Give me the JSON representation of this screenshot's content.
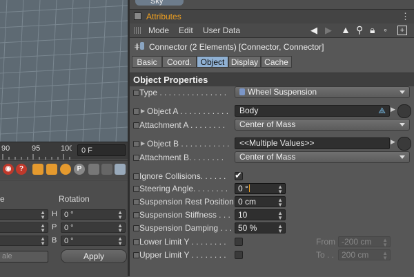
{
  "left": {
    "timeline": {
      "ticks": [
        "90",
        "95",
        "100"
      ],
      "frame_value": "0 F"
    },
    "coord_panel": {
      "col_left_label": "e",
      "col_right_label": "Rotation",
      "rows": [
        {
          "axis": "H",
          "value": "0 °"
        },
        {
          "axis": "P",
          "value": "0 °"
        },
        {
          "axis": "B",
          "value": "0 °"
        }
      ],
      "mode_value": "ale",
      "apply_label": "Apply"
    }
  },
  "attr": {
    "top_tab_label": "Sky",
    "title": "Attributes",
    "menu": [
      "Mode",
      "Edit",
      "User Data"
    ],
    "object_header": "Connector (2 Elements) [Connector, Connector]",
    "tabs": [
      "Basic",
      "Coord.",
      "Object",
      "Display",
      "Cache"
    ],
    "active_tab": "Object",
    "section_title": "Object Properties",
    "fields": {
      "type": {
        "label": "Type . . . . . . . . . . . . . . .",
        "value": "Wheel Suspension"
      },
      "object_a": {
        "label": "Object A . . . . . . . . . . .",
        "value": "Body"
      },
      "attachment_a": {
        "label": "Attachment A . . . . . . . .",
        "value": "Center of Mass"
      },
      "object_b": {
        "label": "Object B . . . . . . . . . . .",
        "value": "<<Multiple Values>>"
      },
      "attachment_b": {
        "label": "Attachment B. . . . . . . .",
        "value": "Center of Mass"
      },
      "ignore_collisions": {
        "label": "Ignore Collisions. . . . . .",
        "checked": true
      },
      "steering_angle": {
        "label": "Steering Angle. . . . . . . .",
        "value": "0 °"
      },
      "suspension_rest_position": {
        "label": "Suspension Rest Position",
        "value": "0 cm"
      },
      "suspension_stiffness": {
        "label": "Suspension Stiffness . . .",
        "value": "10"
      },
      "suspension_damping": {
        "label": "Suspension Damping . . . .",
        "value": "50 %"
      },
      "lower_limit_y": {
        "label": "Lower Limit Y . . . . . . . .",
        "checked": false,
        "from_label": "From",
        "from_value": "-200 cm"
      },
      "upper_limit_y": {
        "label": "Upper Limit Y . . . . . . . .",
        "checked": false,
        "to_label": "To . .",
        "to_value": "200 cm"
      }
    }
  },
  "colors": {
    "accent_orange": "#f0a020",
    "active_tab": "#8fb0d3",
    "panel": "#575757"
  }
}
